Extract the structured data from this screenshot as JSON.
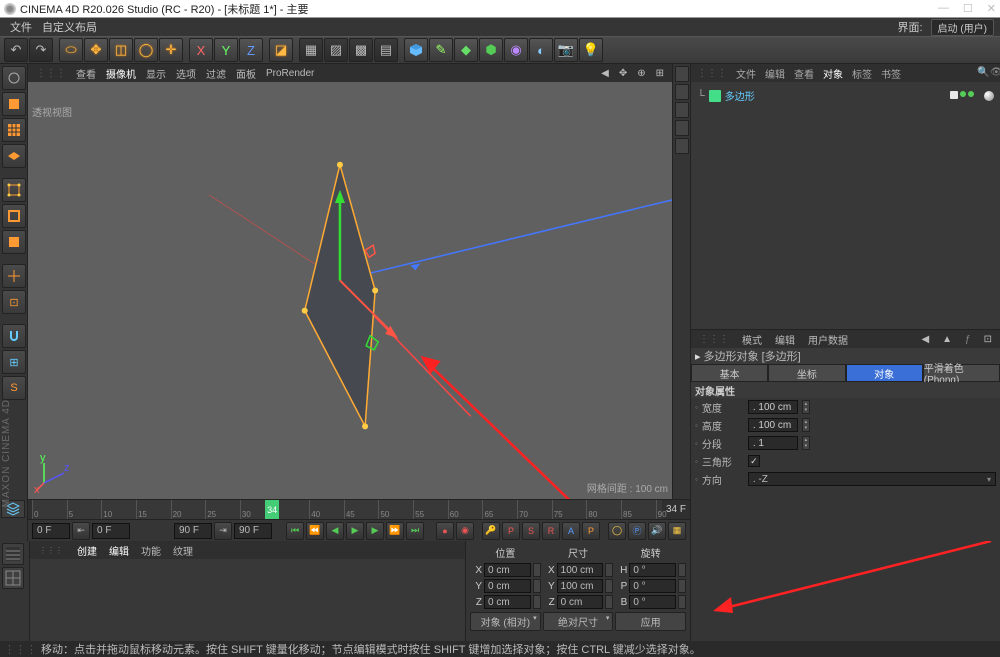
{
  "title": "CINEMA 4D R20.026 Studio (RC - R20) - [未标题 1*] - 主要",
  "menubar": {
    "file": "文件",
    "custom": "自定义布局",
    "iface": "界面:",
    "startup": "启动 (用户)"
  },
  "viewmenu": {
    "view": "查看",
    "camera": "摄像机",
    "disp": "显示",
    "sel": "选项",
    "filter": "过滤",
    "panel": "面板",
    "prorender": "ProRender"
  },
  "viewport": {
    "label": "透视视图",
    "gridinfo": "网格间距 : 100 cm"
  },
  "objpanel": {
    "tabs": {
      "file": "文件",
      "edit": "编辑",
      "view": "查看",
      "object": "对象",
      "tag": "标签",
      "bookmark": "书签"
    },
    "item": "多边形"
  },
  "attr": {
    "tabs": {
      "mode": "模式",
      "edit": "编辑",
      "userdata": "用户数据"
    },
    "header": "多边形对象 [多边形]",
    "subtabs": {
      "basic": "基本",
      "coord": "坐标",
      "object": "对象",
      "phong": "平滑着色(Phong)"
    },
    "section": "对象属性",
    "width_l": "宽度",
    "width_v": ". 100 cm",
    "height_l": "高度",
    "height_v": ". 100 cm",
    "seg_l": "分段",
    "seg_v": ". 1",
    "tri_l": "三角形",
    "dir_l": "方向",
    "dir_v": ". -Z"
  },
  "timeline": {
    "end": "34 F",
    "playhead": "34"
  },
  "playbar": {
    "f1": "0 F",
    "f2": "0 F",
    "f3": "90 F",
    "f4": "90 F"
  },
  "material_tabs": {
    "create": "创建",
    "edit": "编辑",
    "func": "功能",
    "tex": "纹理"
  },
  "coord": {
    "pos": "位置",
    "size": "尺寸",
    "rot": "旋转",
    "x": "X",
    "y": "Y",
    "z": "Z",
    "px": "0 cm",
    "py": "0 cm",
    "pz": "0 cm",
    "sx": "100 cm",
    "sy": "100 cm",
    "sz": "0 cm",
    "rh": "0 °",
    "rp": "0 °",
    "rb": "0 °",
    "h": "H",
    "p": "P",
    "b": "B",
    "btn1": "对象 (相对)",
    "btn2": "绝对尺寸",
    "btn3": "应用"
  },
  "status": "移动：点击并拖动鼠标移动元素。按住 SHIFT 键量化移动；节点编辑模式时按住 SHIFT 键增加选择对象；按住 CTRL 键减少选择对象。",
  "wm": "MAXON CINEMA 4D"
}
